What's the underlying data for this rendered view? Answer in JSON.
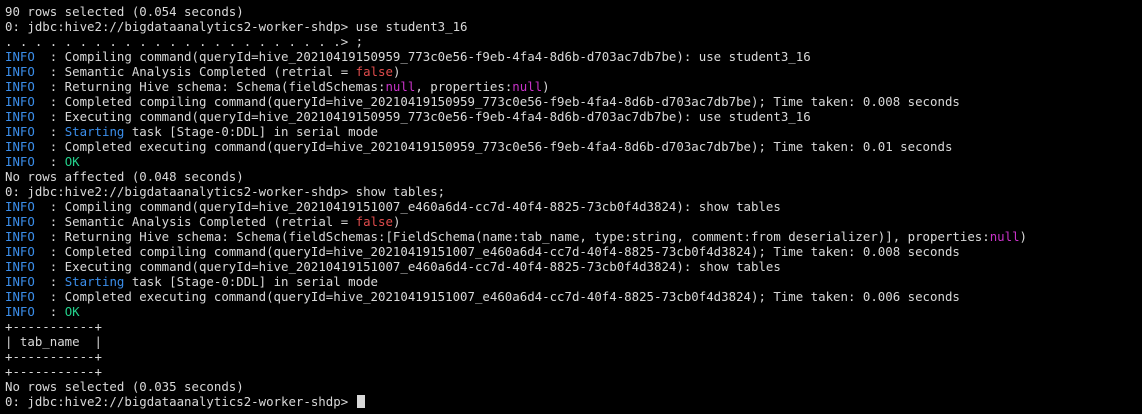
{
  "theme": {
    "background": "#000000",
    "foreground": "#d9d9d9",
    "info": "#3b8eea",
    "false_color": "#e04c4c",
    "null_color": "#c832c8",
    "ok_color": "#23d18b"
  },
  "lines": [
    [
      {
        "t": "90 rows selected (0.054 seconds)"
      }
    ],
    [
      {
        "t": "0: jdbc:hive2://bigdataanalytics2-worker-shdp> use student3_16"
      }
    ],
    [
      {
        "t": ". . . . . . . . . . . . . . . . . . . . . . .> ;"
      }
    ],
    [
      {
        "t": "INFO",
        "c": "info"
      },
      {
        "t": "  : Compiling command(queryId=hive_20210419150959_773c0e56-f9eb-4fa4-8d6b-d703ac7db7be): use student3_16"
      }
    ],
    [
      {
        "t": "INFO",
        "c": "info"
      },
      {
        "t": "  : Semantic Analysis Completed (retrial = "
      },
      {
        "t": "false",
        "c": "red"
      },
      {
        "t": ")"
      }
    ],
    [
      {
        "t": "INFO",
        "c": "info"
      },
      {
        "t": "  : Returning Hive schema: Schema(fieldSchemas:"
      },
      {
        "t": "null",
        "c": "mag"
      },
      {
        "t": ", properties:"
      },
      {
        "t": "null",
        "c": "mag"
      },
      {
        "t": ")"
      }
    ],
    [
      {
        "t": "INFO",
        "c": "info"
      },
      {
        "t": "  : Completed compiling command(queryId=hive_20210419150959_773c0e56-f9eb-4fa4-8d6b-d703ac7db7be); Time taken: 0.008 seconds"
      }
    ],
    [
      {
        "t": "INFO",
        "c": "info"
      },
      {
        "t": "  : Executing command(queryId=hive_20210419150959_773c0e56-f9eb-4fa4-8d6b-d703ac7db7be): use student3_16"
      }
    ],
    [
      {
        "t": "INFO",
        "c": "info"
      },
      {
        "t": "  : "
      },
      {
        "t": "Starting",
        "c": "info"
      },
      {
        "t": " task [Stage-0:DDL] in serial mode"
      }
    ],
    [
      {
        "t": "INFO",
        "c": "info"
      },
      {
        "t": "  : Completed executing command(queryId=hive_20210419150959_773c0e56-f9eb-4fa4-8d6b-d703ac7db7be); Time taken: 0.01 seconds"
      }
    ],
    [
      {
        "t": "INFO",
        "c": "info"
      },
      {
        "t": "  : "
      },
      {
        "t": "OK",
        "c": "grn"
      }
    ],
    [
      {
        "t": "No rows affected (0.048 seconds)"
      }
    ],
    [
      {
        "t": "0: jdbc:hive2://bigdataanalytics2-worker-shdp> show tables;"
      }
    ],
    [
      {
        "t": "INFO",
        "c": "info"
      },
      {
        "t": "  : Compiling command(queryId=hive_20210419151007_e460a6d4-cc7d-40f4-8825-73cb0f4d3824): show tables"
      }
    ],
    [
      {
        "t": "INFO",
        "c": "info"
      },
      {
        "t": "  : Semantic Analysis Completed (retrial = "
      },
      {
        "t": "false",
        "c": "red"
      },
      {
        "t": ")"
      }
    ],
    [
      {
        "t": "INFO",
        "c": "info"
      },
      {
        "t": "  : Returning Hive schema: Schema(fieldSchemas:[FieldSchema(name:tab_name, type:string, comment:from deserializer)], properties:"
      },
      {
        "t": "null",
        "c": "mag"
      },
      {
        "t": ")"
      }
    ],
    [
      {
        "t": "INFO",
        "c": "info"
      },
      {
        "t": "  : Completed compiling command(queryId=hive_20210419151007_e460a6d4-cc7d-40f4-8825-73cb0f4d3824); Time taken: 0.008 seconds"
      }
    ],
    [
      {
        "t": "INFO",
        "c": "info"
      },
      {
        "t": "  : Executing command(queryId=hive_20210419151007_e460a6d4-cc7d-40f4-8825-73cb0f4d3824): show tables"
      }
    ],
    [
      {
        "t": "INFO",
        "c": "info"
      },
      {
        "t": "  : "
      },
      {
        "t": "Starting",
        "c": "info"
      },
      {
        "t": " task [Stage-0:DDL] in serial mode"
      }
    ],
    [
      {
        "t": "INFO",
        "c": "info"
      },
      {
        "t": "  : Completed executing command(queryId=hive_20210419151007_e460a6d4-cc7d-40f4-8825-73cb0f4d3824); Time taken: 0.006 seconds"
      }
    ],
    [
      {
        "t": "INFO",
        "c": "info"
      },
      {
        "t": "  : "
      },
      {
        "t": "OK",
        "c": "grn"
      }
    ],
    [
      {
        "t": "+-----------+"
      }
    ],
    [
      {
        "t": "| tab_name  |"
      }
    ],
    [
      {
        "t": "+-----------+"
      }
    ],
    [
      {
        "t": "+-----------+"
      }
    ],
    [
      {
        "t": "No rows selected (0.035 seconds)"
      }
    ],
    [
      {
        "t": "0: jdbc:hive2://bigdataanalytics2-worker-shdp> "
      }
    ]
  ]
}
